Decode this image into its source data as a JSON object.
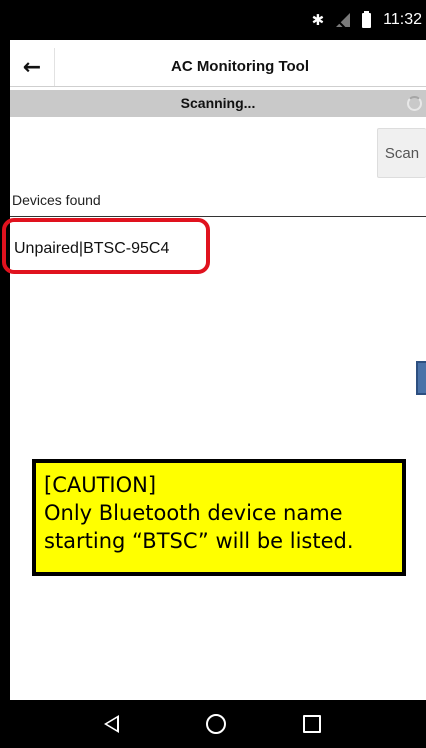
{
  "status_bar": {
    "time": "11:32",
    "icons": [
      "bluetooth-icon",
      "signal-off-icon",
      "battery-icon"
    ],
    "bluetooth_glyph": "✱"
  },
  "app_bar": {
    "back_icon": "←",
    "title": "AC Monitoring Tool"
  },
  "scan_bar": {
    "status": "Scanning...",
    "spinner_icon": "spinner-icon"
  },
  "scan_button": {
    "label": "Scan"
  },
  "devices": {
    "header": "Devices found",
    "items": [
      {
        "label": "Unpaired|BTSC-95C4"
      }
    ]
  },
  "annotation": {
    "highlight_color": "#e0121e",
    "caution_lines": [
      "[CAUTION]",
      "Only Bluetooth device name",
      "starting “BTSC” will be listed."
    ],
    "caution_background": "#ffff00"
  },
  "nav_bar": {
    "buttons": [
      "back-icon",
      "home-icon",
      "recents-icon"
    ]
  }
}
